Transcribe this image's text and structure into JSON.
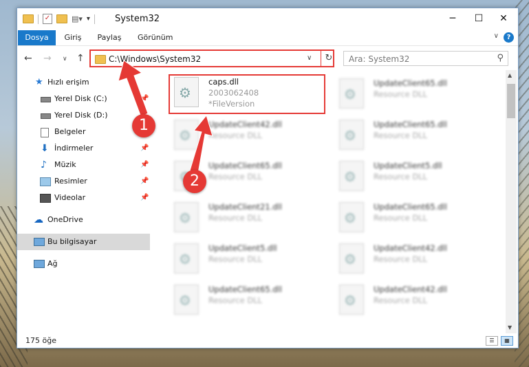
{
  "window": {
    "title": "System32",
    "minimize": "─",
    "maximize": "☐",
    "close": "✕"
  },
  "ribbon": {
    "tabs": [
      "Dosya",
      "Giriş",
      "Paylaş",
      "Görünüm"
    ],
    "help": "?",
    "collapse": "∨"
  },
  "nav": {
    "back": "←",
    "forward": "→",
    "recent": "∨",
    "up": "↑",
    "refresh": "↻"
  },
  "address": {
    "path": "C:\\Windows\\System32",
    "dropdown": "∨"
  },
  "search": {
    "placeholder": "Ara: System32",
    "icon": "⚲"
  },
  "sidebar": {
    "items": [
      {
        "label": "Hızlı erişim",
        "icon": "star-icon",
        "color": "#2a7bd4"
      },
      {
        "label": "Yerel Disk (C:)",
        "icon": "drive-icon",
        "pinned": true
      },
      {
        "label": "Yerel Disk (D:)",
        "icon": "drive-icon",
        "pinned": false
      },
      {
        "label": "Belgeler",
        "icon": "documents-icon",
        "pinned": true
      },
      {
        "label": "İndirmeler",
        "icon": "download-icon",
        "pinned": true
      },
      {
        "label": "Müzik",
        "icon": "music-icon",
        "pinned": true
      },
      {
        "label": "Resimler",
        "icon": "pictures-icon",
        "pinned": true
      },
      {
        "label": "Videolar",
        "icon": "video-icon",
        "pinned": true
      },
      {
        "label": "OneDrive",
        "icon": "cloud-icon",
        "color": "#1565c0"
      },
      {
        "label": "Bu bilgisayar",
        "icon": "computer-icon",
        "selected": true
      },
      {
        "label": "Ağ",
        "icon": "network-icon"
      }
    ]
  },
  "files": [
    {
      "name": "caps.dll",
      "line2": "2003062408",
      "line3": "*FileVersion",
      "highlighted": true
    },
    {
      "name": "UpdateClient65.dll",
      "line2": "Resource DLL"
    },
    {
      "name": "UpdateClient42.dll",
      "line2": "Resource DLL"
    },
    {
      "name": "UpdateClient65.dll",
      "line2": "Resource DLL"
    },
    {
      "name": "UpdateClient65.dll",
      "line2": "Resource DLL"
    },
    {
      "name": "UpdateClient5.dll",
      "line2": "Resource DLL"
    },
    {
      "name": "UpdateClient21.dll",
      "line2": "Resource DLL"
    },
    {
      "name": "UpdateClient65.dll",
      "line2": "Resource DLL"
    },
    {
      "name": "UpdateClient5.dll",
      "line2": "Resource DLL"
    },
    {
      "name": "UpdateClient42.dll",
      "line2": "Resource DLL"
    },
    {
      "name": "UpdateClient65.dll",
      "line2": "Resource DLL"
    },
    {
      "name": "UpdateClient42.dll",
      "line2": "Resource DLL"
    }
  ],
  "status": {
    "count": "175 öğe"
  },
  "annotations": {
    "badge1": "1",
    "badge2": "2",
    "color": "#e53935"
  }
}
